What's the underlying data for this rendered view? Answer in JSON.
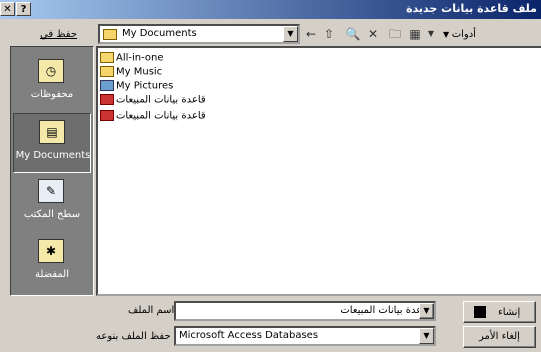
{
  "window": {
    "title": "ملف قاعدة بيانات جديدة",
    "help_glyph": "?",
    "close_glyph": "✕"
  },
  "toolbar": {
    "save_in_label": "حفظ في",
    "location": "My Documents",
    "tools_label": "أدوات",
    "icons": [
      "back-icon",
      "up-folder-icon",
      "search-web-icon",
      "delete-icon",
      "new-folder-icon",
      "views-icon"
    ]
  },
  "places": [
    {
      "label": "محفوظات",
      "icon": "history-icon",
      "selected": false
    },
    {
      "label": "My Documents",
      "icon": "my-documents-icon",
      "selected": true
    },
    {
      "label": "سطح المكتب",
      "icon": "desktop-icon",
      "selected": false
    },
    {
      "label": "المفضلة",
      "icon": "favorites-icon",
      "selected": false
    }
  ],
  "files": [
    {
      "name": "All-in-one",
      "type": "folder"
    },
    {
      "name": "My Music",
      "type": "folder"
    },
    {
      "name": "My Pictures",
      "type": "pictures-folder"
    },
    {
      "name": "قاعدة بيانات المبيعات",
      "type": "access-db"
    },
    {
      "name": "قاعدة بيانات المبيعات",
      "type": "access-db"
    }
  ],
  "bottom": {
    "filename_label": "اسم الملف",
    "filename_value": "قاعدة بيانات المبيعات",
    "filetype_label": "حفظ الملف بنوعه",
    "filetype_value": "Microsoft Access Databases",
    "create_button": "إنشاء",
    "cancel_button": "إلغاء الأمر"
  }
}
